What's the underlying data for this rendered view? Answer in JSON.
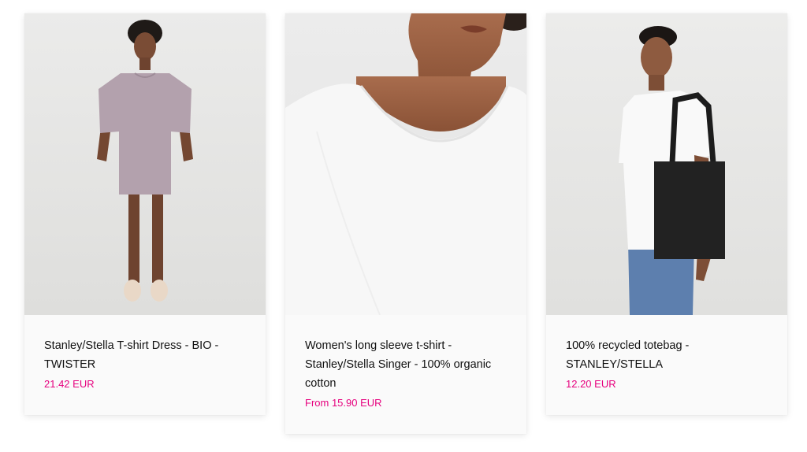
{
  "products": [
    {
      "title": "Stanley/Stella T-shirt Dress - BIO - TWISTER",
      "price": "21.42 EUR",
      "image": "woman-in-lilac-tshirt-dress-photo"
    },
    {
      "title": "Women's long sleeve t-shirt - Stanley/Stella Singer - 100% organic cotton",
      "price": "From 15.90 EUR",
      "image": "white-long-sleeve-tshirt-closeup-photo"
    },
    {
      "title": "100% recycled totebag - STANLEY/STELLA",
      "price": "12.20 EUR",
      "image": "man-with-black-totebag-photo"
    }
  ],
  "colors": {
    "price": "#e6007e",
    "title": "#111111",
    "info_background": "#fafafa"
  }
}
